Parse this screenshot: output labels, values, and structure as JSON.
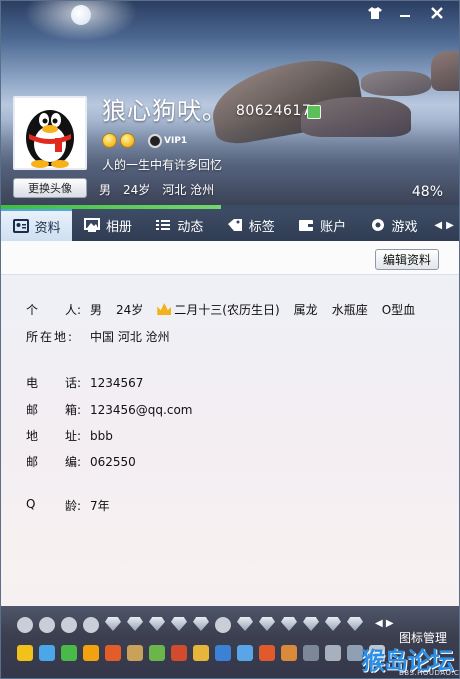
{
  "window": {
    "controls": [
      "skin-icon",
      "minimize-icon",
      "close-icon"
    ]
  },
  "profile": {
    "nickname": "狼心狗吠。",
    "qq_number": "80624617",
    "vip_label": "VIP1",
    "signature": "人的一生中有许多回忆",
    "gender": "男",
    "age": "24岁",
    "location": "河北 沧州",
    "completion": "48%",
    "completion_fraction": 0.48,
    "change_avatar_label": "更换头像"
  },
  "tabs": [
    {
      "label": "资料",
      "icon": "profile-card-icon",
      "active": true
    },
    {
      "label": "相册",
      "icon": "photo-album-icon",
      "active": false
    },
    {
      "label": "动态",
      "icon": "feed-icon",
      "active": false
    },
    {
      "label": "标签",
      "icon": "tag-icon",
      "active": false
    },
    {
      "label": "账户",
      "icon": "wallet-icon",
      "active": false
    },
    {
      "label": "游戏",
      "icon": "game-icon",
      "active": false
    }
  ],
  "edit_button": "编辑资料",
  "details": {
    "personal": {
      "label_a": "个",
      "label_b": "人:",
      "gender": "男",
      "age": "24岁",
      "birthday": "二月十三(农历生日)",
      "zodiac": "属龙",
      "constellation": "水瓶座",
      "blood": "O型血"
    },
    "location": {
      "label": "所在地:",
      "value": "中国 河北 沧州"
    },
    "phone": {
      "label_a": "电",
      "label_b": "话:",
      "value": "1234567"
    },
    "email": {
      "label_a": "邮",
      "label_b": "箱:",
      "value": "123456@qq.com"
    },
    "address": {
      "label_a": "地",
      "label_b": "址:",
      "value": "bbb"
    },
    "postcode": {
      "label_a": "邮",
      "label_b": "编:",
      "value": "062550"
    },
    "qq_age": {
      "label_a": "Q",
      "label_b": "龄:",
      "value": "7年"
    }
  },
  "icon_bar": {
    "manage_label": "图标管理",
    "watermark_big": "猴岛论坛",
    "watermark_small": "BBS.HOUDAO.COM"
  },
  "colors": {
    "accent": "#53a6e6",
    "progress": "#3dbd41",
    "tab_bar": "#34415a"
  }
}
